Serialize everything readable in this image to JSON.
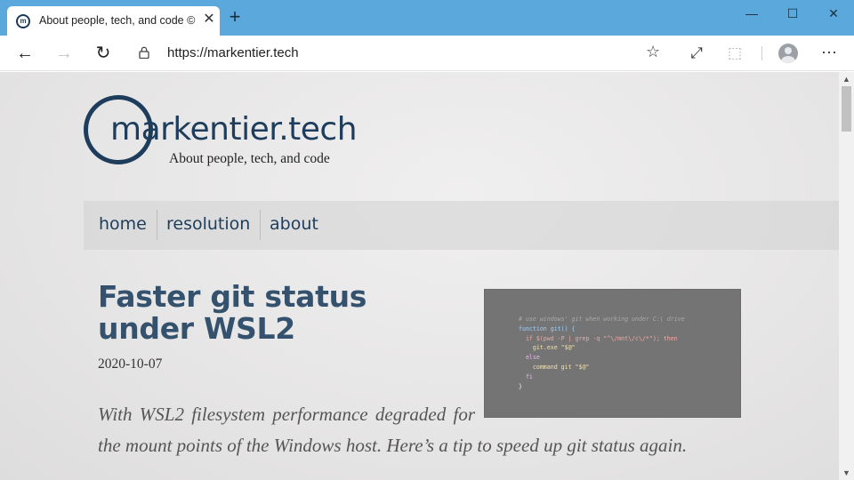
{
  "browser": {
    "tab": {
      "favicon_letter": "m",
      "title": "About people, tech, and code ©",
      "close_glyph": "✕"
    },
    "new_tab_glyph": "+",
    "window_controls": {
      "minimize": "—",
      "maximize": "☐",
      "close": "✕"
    },
    "nav": {
      "back": "←",
      "forward": "→",
      "refresh": "↻"
    },
    "address": {
      "url": "https://markentier.tech",
      "favorite_glyph": "☆"
    },
    "toolbar": {
      "immersive_reader": "⤢",
      "extensions": "⬚",
      "more": "···"
    }
  },
  "site": {
    "logo": {
      "text": "markentier.tech",
      "tagline": "About people, tech, and code"
    },
    "nav_items": [
      {
        "label": "home"
      },
      {
        "label": "resolution"
      },
      {
        "label": "about"
      }
    ]
  },
  "post": {
    "title": "Faster git status under WSL2",
    "date": "2020-10-07",
    "excerpt_line1": "With WSL2 filesystem performance degraded for",
    "excerpt_line2": "the mount points of the Windows host. Here’s a tip to speed up git status again.",
    "code_image": {
      "comment": "# use windows' git when working under C:\\ drive",
      "line2": "function git() {",
      "line3_if": "if $(pwd -P | grep -q \"^\\/mnt\\/c\\/*\"); then",
      "line4": "git.exe \"$@\"",
      "line5": "else",
      "line6": "command git \"$@\"",
      "line7": "fi",
      "line8": "}"
    }
  },
  "colors": {
    "brand": "#1e3d5c",
    "title": "#34516e",
    "titlebar": "#5aa8dc"
  }
}
